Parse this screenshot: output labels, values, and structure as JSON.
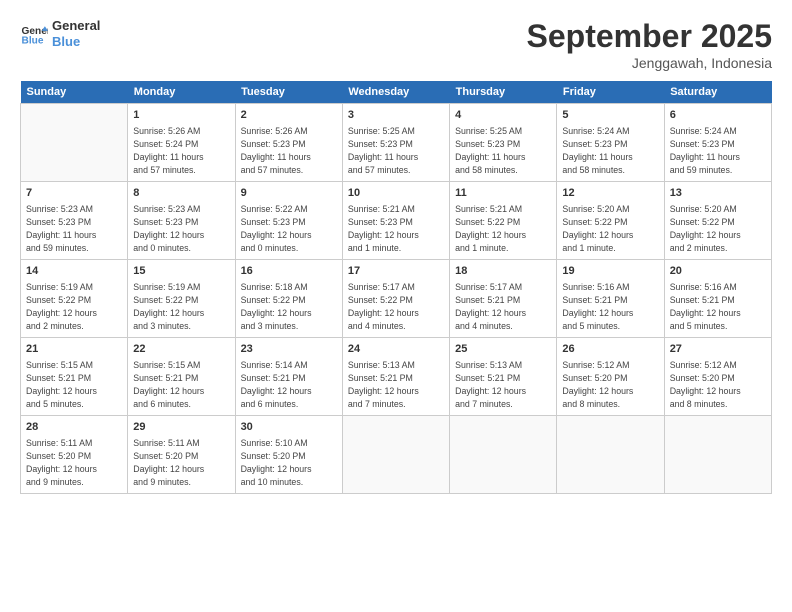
{
  "header": {
    "logo_line1": "General",
    "logo_line2": "Blue",
    "month": "September 2025",
    "location": "Jenggawah, Indonesia"
  },
  "days_of_week": [
    "Sunday",
    "Monday",
    "Tuesday",
    "Wednesday",
    "Thursday",
    "Friday",
    "Saturday"
  ],
  "weeks": [
    [
      {
        "day": "",
        "info": ""
      },
      {
        "day": "1",
        "info": "Sunrise: 5:26 AM\nSunset: 5:24 PM\nDaylight: 11 hours\nand 57 minutes."
      },
      {
        "day": "2",
        "info": "Sunrise: 5:26 AM\nSunset: 5:23 PM\nDaylight: 11 hours\nand 57 minutes."
      },
      {
        "day": "3",
        "info": "Sunrise: 5:25 AM\nSunset: 5:23 PM\nDaylight: 11 hours\nand 57 minutes."
      },
      {
        "day": "4",
        "info": "Sunrise: 5:25 AM\nSunset: 5:23 PM\nDaylight: 11 hours\nand 58 minutes."
      },
      {
        "day": "5",
        "info": "Sunrise: 5:24 AM\nSunset: 5:23 PM\nDaylight: 11 hours\nand 58 minutes."
      },
      {
        "day": "6",
        "info": "Sunrise: 5:24 AM\nSunset: 5:23 PM\nDaylight: 11 hours\nand 59 minutes."
      }
    ],
    [
      {
        "day": "7",
        "info": "Sunrise: 5:23 AM\nSunset: 5:23 PM\nDaylight: 11 hours\nand 59 minutes."
      },
      {
        "day": "8",
        "info": "Sunrise: 5:23 AM\nSunset: 5:23 PM\nDaylight: 12 hours\nand 0 minutes."
      },
      {
        "day": "9",
        "info": "Sunrise: 5:22 AM\nSunset: 5:23 PM\nDaylight: 12 hours\nand 0 minutes."
      },
      {
        "day": "10",
        "info": "Sunrise: 5:21 AM\nSunset: 5:23 PM\nDaylight: 12 hours\nand 1 minute."
      },
      {
        "day": "11",
        "info": "Sunrise: 5:21 AM\nSunset: 5:22 PM\nDaylight: 12 hours\nand 1 minute."
      },
      {
        "day": "12",
        "info": "Sunrise: 5:20 AM\nSunset: 5:22 PM\nDaylight: 12 hours\nand 1 minute."
      },
      {
        "day": "13",
        "info": "Sunrise: 5:20 AM\nSunset: 5:22 PM\nDaylight: 12 hours\nand 2 minutes."
      }
    ],
    [
      {
        "day": "14",
        "info": "Sunrise: 5:19 AM\nSunset: 5:22 PM\nDaylight: 12 hours\nand 2 minutes."
      },
      {
        "day": "15",
        "info": "Sunrise: 5:19 AM\nSunset: 5:22 PM\nDaylight: 12 hours\nand 3 minutes."
      },
      {
        "day": "16",
        "info": "Sunrise: 5:18 AM\nSunset: 5:22 PM\nDaylight: 12 hours\nand 3 minutes."
      },
      {
        "day": "17",
        "info": "Sunrise: 5:17 AM\nSunset: 5:22 PM\nDaylight: 12 hours\nand 4 minutes."
      },
      {
        "day": "18",
        "info": "Sunrise: 5:17 AM\nSunset: 5:21 PM\nDaylight: 12 hours\nand 4 minutes."
      },
      {
        "day": "19",
        "info": "Sunrise: 5:16 AM\nSunset: 5:21 PM\nDaylight: 12 hours\nand 5 minutes."
      },
      {
        "day": "20",
        "info": "Sunrise: 5:16 AM\nSunset: 5:21 PM\nDaylight: 12 hours\nand 5 minutes."
      }
    ],
    [
      {
        "day": "21",
        "info": "Sunrise: 5:15 AM\nSunset: 5:21 PM\nDaylight: 12 hours\nand 5 minutes."
      },
      {
        "day": "22",
        "info": "Sunrise: 5:15 AM\nSunset: 5:21 PM\nDaylight: 12 hours\nand 6 minutes."
      },
      {
        "day": "23",
        "info": "Sunrise: 5:14 AM\nSunset: 5:21 PM\nDaylight: 12 hours\nand 6 minutes."
      },
      {
        "day": "24",
        "info": "Sunrise: 5:13 AM\nSunset: 5:21 PM\nDaylight: 12 hours\nand 7 minutes."
      },
      {
        "day": "25",
        "info": "Sunrise: 5:13 AM\nSunset: 5:21 PM\nDaylight: 12 hours\nand 7 minutes."
      },
      {
        "day": "26",
        "info": "Sunrise: 5:12 AM\nSunset: 5:20 PM\nDaylight: 12 hours\nand 8 minutes."
      },
      {
        "day": "27",
        "info": "Sunrise: 5:12 AM\nSunset: 5:20 PM\nDaylight: 12 hours\nand 8 minutes."
      }
    ],
    [
      {
        "day": "28",
        "info": "Sunrise: 5:11 AM\nSunset: 5:20 PM\nDaylight: 12 hours\nand 9 minutes."
      },
      {
        "day": "29",
        "info": "Sunrise: 5:11 AM\nSunset: 5:20 PM\nDaylight: 12 hours\nand 9 minutes."
      },
      {
        "day": "30",
        "info": "Sunrise: 5:10 AM\nSunset: 5:20 PM\nDaylight: 12 hours\nand 10 minutes."
      },
      {
        "day": "",
        "info": ""
      },
      {
        "day": "",
        "info": ""
      },
      {
        "day": "",
        "info": ""
      },
      {
        "day": "",
        "info": ""
      }
    ]
  ]
}
